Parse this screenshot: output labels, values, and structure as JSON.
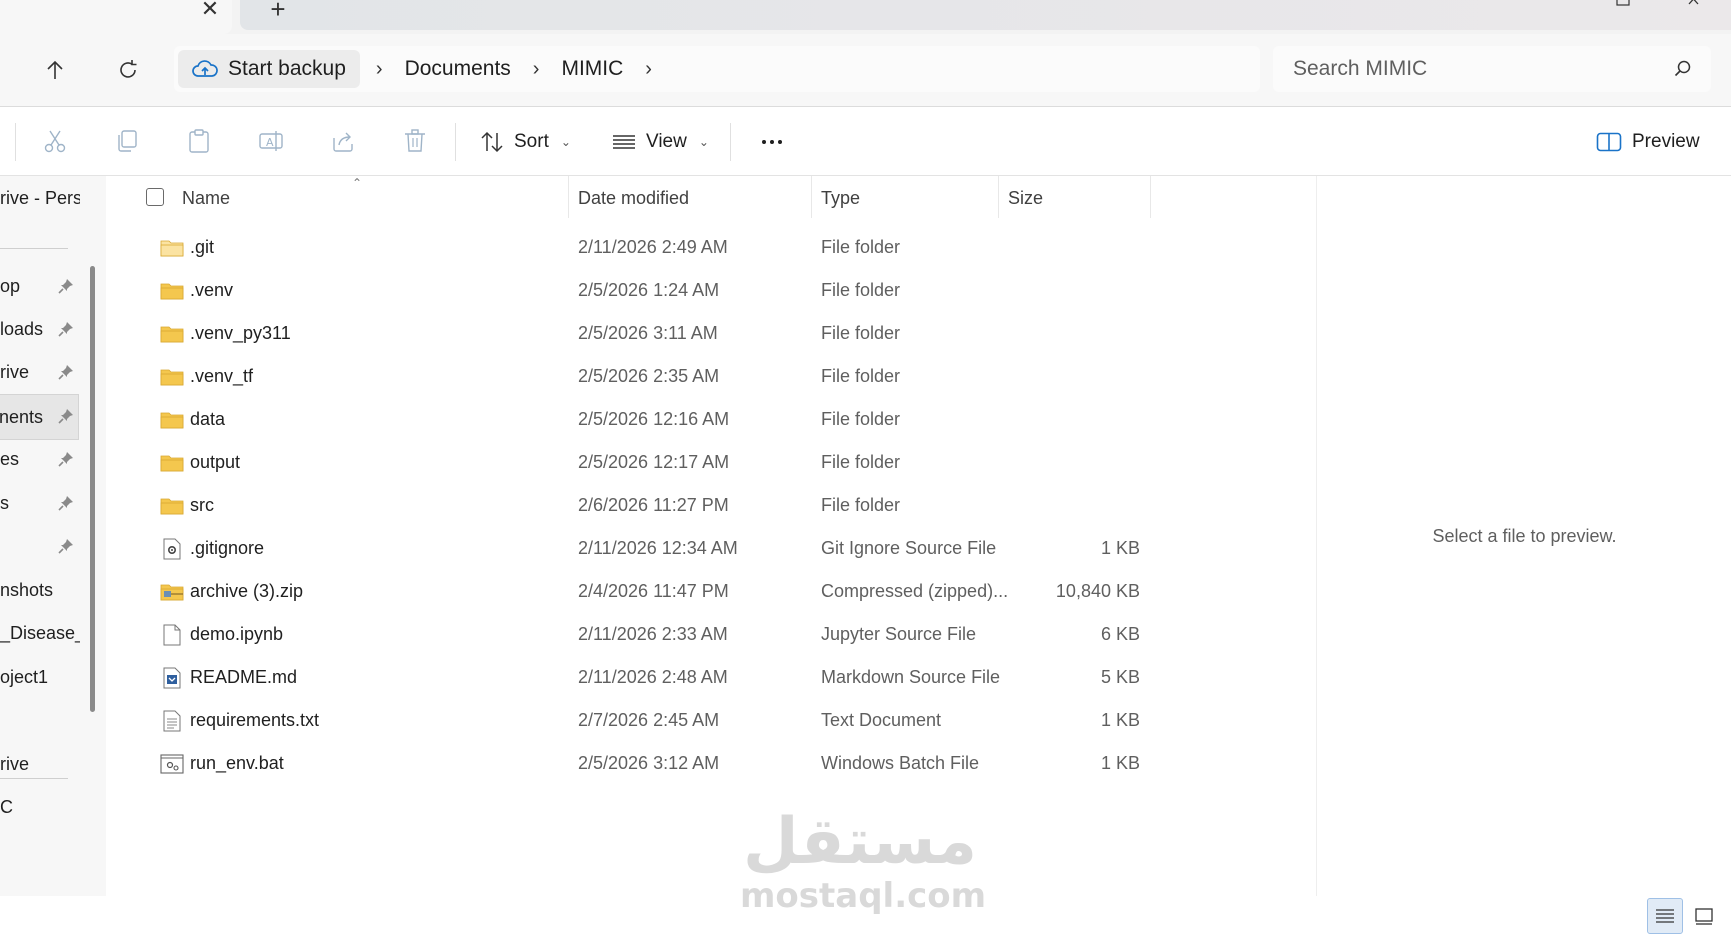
{
  "titlebar": {
    "close_glyph": "✕",
    "new_tab_glyph": "+"
  },
  "address": {
    "backup_label": "Start backup",
    "crumbs": [
      "Documents",
      "MIMIC"
    ],
    "search_placeholder": "Search MIMIC"
  },
  "toolbar": {
    "sort_label": "Sort",
    "view_label": "View",
    "preview_label": "Preview"
  },
  "sidebar": {
    "items": [
      {
        "label": "rive - Perso",
        "pinned": false
      },
      {
        "label": "op",
        "pinned": true
      },
      {
        "label": "loads",
        "pinned": true
      },
      {
        "label": "rive",
        "pinned": true
      },
      {
        "label": "nents",
        "pinned": true,
        "selected": true
      },
      {
        "label": "es",
        "pinned": true
      },
      {
        "label": "s",
        "pinned": true
      },
      {
        "label": "",
        "pinned": true
      },
      {
        "label": "nshots",
        "pinned": false
      },
      {
        "label": "_Disease_A",
        "pinned": false
      },
      {
        "label": "oject1",
        "pinned": false
      },
      {
        "label": "rive",
        "pinned": false
      },
      {
        "label": "C",
        "pinned": false
      }
    ]
  },
  "columns": {
    "name": "Name",
    "date": "Date modified",
    "type": "Type",
    "size": "Size"
  },
  "files": [
    {
      "name": ".git",
      "date": "2/11/2026 2:49 AM",
      "type": "File folder",
      "size": "",
      "icon": "folder-light-icon"
    },
    {
      "name": ".venv",
      "date": "2/5/2026 1:24 AM",
      "type": "File folder",
      "size": "",
      "icon": "folder-icon"
    },
    {
      "name": ".venv_py311",
      "date": "2/5/2026 3:11 AM",
      "type": "File folder",
      "size": "",
      "icon": "folder-icon"
    },
    {
      "name": ".venv_tf",
      "date": "2/5/2026 2:35 AM",
      "type": "File folder",
      "size": "",
      "icon": "folder-icon"
    },
    {
      "name": "data",
      "date": "2/5/2026 12:16 AM",
      "type": "File folder",
      "size": "",
      "icon": "folder-icon"
    },
    {
      "name": "output",
      "date": "2/5/2026 12:17 AM",
      "type": "File folder",
      "size": "",
      "icon": "folder-icon"
    },
    {
      "name": "src",
      "date": "2/6/2026 11:27 PM",
      "type": "File folder",
      "size": "",
      "icon": "folder-icon"
    },
    {
      "name": ".gitignore",
      "date": "2/11/2026 12:34 AM",
      "type": "Git Ignore Source File",
      "size": "1 KB",
      "icon": "settings-file-icon"
    },
    {
      "name": "archive (3).zip",
      "date": "2/4/2026 11:47 PM",
      "type": "Compressed (zipped)...",
      "size": "10,840 KB",
      "icon": "zip-folder-icon"
    },
    {
      "name": "demo.ipynb",
      "date": "2/11/2026 2:33 AM",
      "type": "Jupyter Source File",
      "size": "6 KB",
      "icon": "document-icon"
    },
    {
      "name": "README.md",
      "date": "2/11/2026 2:48 AM",
      "type": "Markdown Source File",
      "size": "5 KB",
      "icon": "markdown-file-icon"
    },
    {
      "name": "requirements.txt",
      "date": "2/7/2026 2:45 AM",
      "type": "Text Document",
      "size": "1 KB",
      "icon": "text-file-icon"
    },
    {
      "name": "run_env.bat",
      "date": "2/5/2026 3:12 AM",
      "type": "Windows Batch File",
      "size": "1 KB",
      "icon": "batch-file-icon"
    }
  ],
  "preview": {
    "empty_text": "Select a file to preview."
  },
  "watermark": {
    "arabic": "مستقل",
    "latin": "mostaql.com"
  },
  "colors": {
    "folder": "#f4c74e",
    "folder_light": "#fbe3a2",
    "selection": "#e6e6e6",
    "accent": "#1a73c8"
  }
}
